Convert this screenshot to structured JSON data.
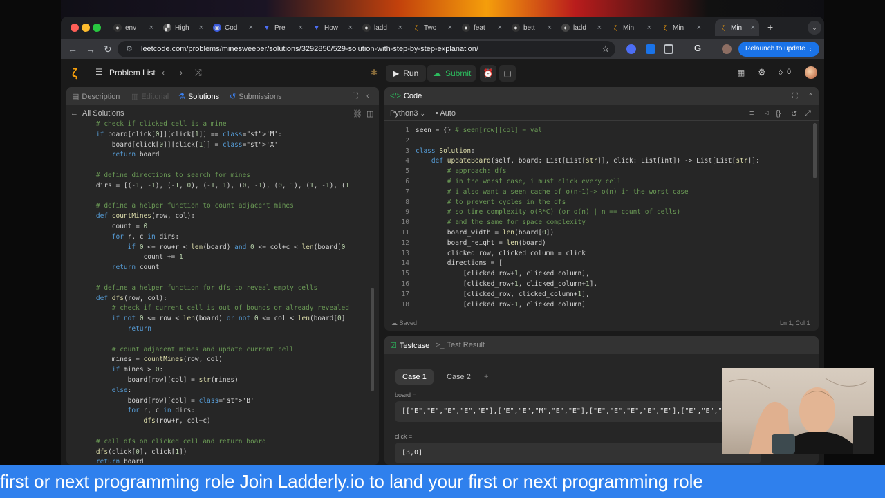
{
  "browser": {
    "tabs": [
      {
        "label": "env"
      },
      {
        "label": "High"
      },
      {
        "label": "Cod"
      },
      {
        "label": "Pre"
      },
      {
        "label": "How"
      },
      {
        "label": "ladd"
      },
      {
        "label": "Two"
      },
      {
        "label": "feat"
      },
      {
        "label": "bett"
      },
      {
        "label": "ladd"
      },
      {
        "label": "Min"
      },
      {
        "label": "Min"
      },
      {
        "label": "Min"
      }
    ],
    "url": "leetcode.com/problems/minesweeper/solutions/3292850/529-solution-with-step-by-step-explanation/",
    "relaunch_label": "Relaunch to update"
  },
  "header": {
    "problem_list": "Problem List",
    "run": "Run",
    "submit": "Submit",
    "notifications": "0"
  },
  "left_pane": {
    "tabs": {
      "description": "Description",
      "editorial": "Editorial",
      "solutions": "Solutions",
      "submissions": "Submissions"
    },
    "back_label": "All Solutions",
    "code_lines": [
      "    # check if clicked cell is a mine",
      "    if board[click[0]][click[1]] == 'M':",
      "        board[click[0]][click[1]] = 'X'",
      "        return board",
      "",
      "    # define directions to search for mines",
      "    dirs = [(-1, -1), (-1, 0), (-1, 1), (0, -1), (0, 1), (1, -1), (1",
      "",
      "    # define a helper function to count adjacent mines",
      "    def countMines(row, col):",
      "        count = 0",
      "        for r, c in dirs:",
      "            if 0 <= row+r < len(board) and 0 <= col+c < len(board[0",
      "                count += 1",
      "        return count",
      "",
      "    # define a helper function for dfs to reveal empty cells",
      "    def dfs(row, col):",
      "        # check if current cell is out of bounds or already revealed",
      "        if not 0 <= row < len(board) or not 0 <= col < len(board[0]",
      "            return",
      "",
      "        # count adjacent mines and update current cell",
      "        mines = countMines(row, col)",
      "        if mines > 0:",
      "            board[row][col] = str(mines)",
      "        else:",
      "            board[row][col] = 'B'",
      "            for r, c in dirs:",
      "                dfs(row+r, col+c)",
      "",
      "    # call dfs on clicked cell and return board",
      "    dfs(click[0], click[1])",
      "    return board"
    ]
  },
  "code_pane": {
    "title": "Code",
    "language": "Python3",
    "mode": "Auto",
    "status": "Saved",
    "cursor": "Ln 1, Col 1",
    "line_numbers": [
      "1",
      "2",
      "3",
      "4",
      "5",
      "6",
      "7",
      "8",
      "9",
      "10",
      "11",
      "12",
      "13",
      "14",
      "15",
      "16",
      "17",
      "18"
    ],
    "lines": [
      "seen = {} # seen[row][col] = val",
      "",
      "class Solution:",
      "    def updateBoard(self, board: List[List[str]], click: List[int]) -> List[List[str]]:",
      "        # approach: dfs",
      "        # in the worst case, i must click every cell",
      "        # i also want a seen cache of o(n-1)-> o(n) in the worst case",
      "        # to prevent cycles in the dfs",
      "        # so time complexity o(R*C) (or o(n) | n == count of cells)",
      "        # and the same for space complexity",
      "        board_width = len(board[0])",
      "        board_height = len(board)",
      "        clicked_row, clicked_column = click",
      "        directions = [",
      "            [clicked_row+1, clicked_column],",
      "            [clicked_row+1, clicked_column+1],",
      "            [clicked_row, clicked_column+1],",
      "            [clicked_row-1, clicked_column]"
    ]
  },
  "testcase_pane": {
    "tab_testcase": "Testcase",
    "tab_result": "Test Result",
    "case1": "Case 1",
    "case2": "Case 2",
    "add": "+",
    "board_label": "board =",
    "board_value": "[[\"E\",\"E\",\"E\",\"E\",\"E\"],[\"E\",\"E\",\"M\",\"E\",\"E\"],[\"E\",\"E\",\"E\",\"E\",\"E\"],[\"E\",\"E\",\"E\",\"E\",\"E\"]]",
    "click_label": "click =",
    "click_value": "[3,0]"
  },
  "banner": {
    "text": "first or next programming role          Join Ladderly.io to land your first or next programming role"
  }
}
